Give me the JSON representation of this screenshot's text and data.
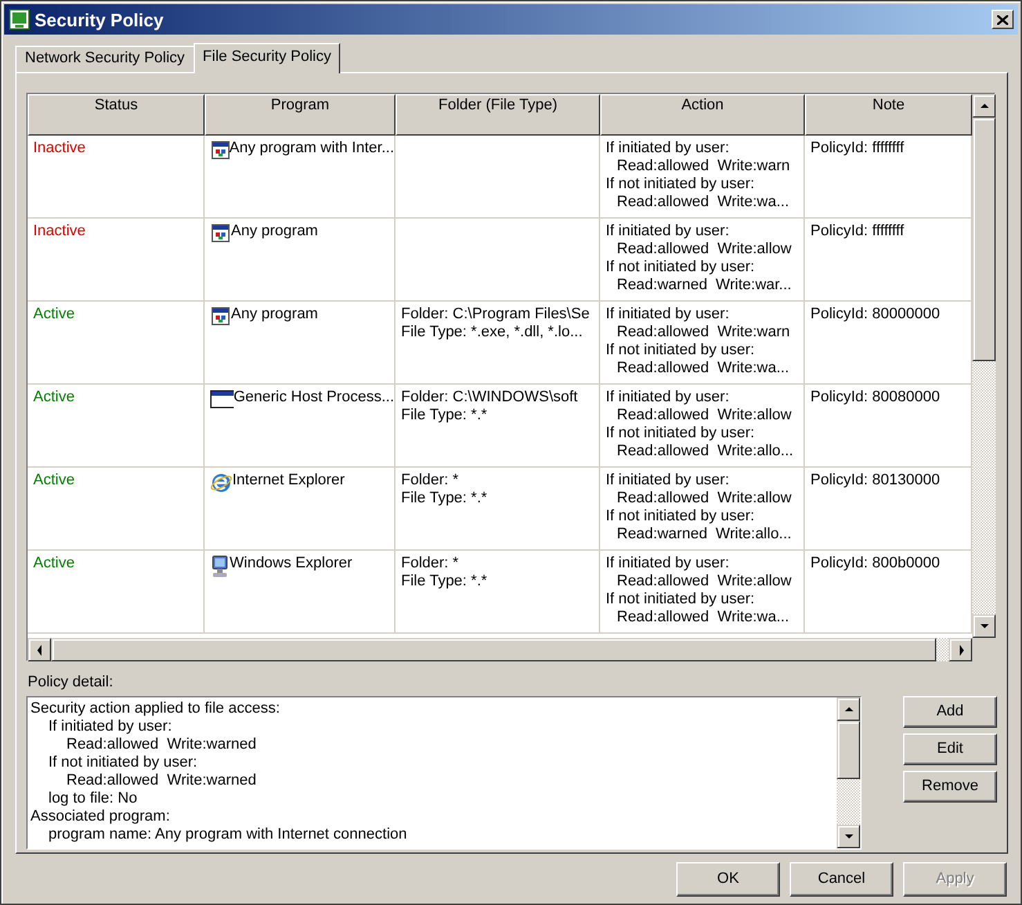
{
  "window": {
    "title": "Security Policy"
  },
  "tabs": [
    {
      "label": "Network Security Policy",
      "selected": false
    },
    {
      "label": "File Security Policy",
      "selected": true
    }
  ],
  "table": {
    "columns": [
      "Status",
      "Program",
      "Folder (File Type)",
      "Action",
      "Note"
    ],
    "rows": [
      {
        "status": "Inactive",
        "active": false,
        "program": "Any program with Inter...",
        "kind": "app",
        "folder": [],
        "action": [
          "If initiated by user:",
          "Read:allowed  Write:warn",
          "If not initiated by user:",
          "Read:allowed  Write:wa..."
        ],
        "note": "PolicyId: ffffffff"
      },
      {
        "status": "Inactive",
        "active": false,
        "program": "Any program",
        "kind": "app",
        "folder": [],
        "action": [
          "If initiated by user:",
          "Read:allowed  Write:allow",
          "If not initiated by user:",
          "Read:warned  Write:war..."
        ],
        "note": "PolicyId: ffffffff"
      },
      {
        "status": "Active",
        "active": true,
        "program": "Any program",
        "kind": "app",
        "folder": [
          "Folder: C:\\Program Files\\Se",
          "File Type: *.exe, *.dll, *.lo..."
        ],
        "action": [
          "If initiated by user:",
          "Read:allowed  Write:warn",
          "If not initiated by user:",
          "Read:allowed  Write:wa..."
        ],
        "note": "PolicyId: 80000000"
      },
      {
        "status": "Active",
        "active": true,
        "program": "Generic Host Process...",
        "kind": "window",
        "folder": [
          "Folder: C:\\WINDOWS\\soft",
          "File Type: *.*"
        ],
        "action": [
          "If initiated by user:",
          "Read:allowed  Write:allow",
          "If not initiated by user:",
          "Read:allowed  Write:allo..."
        ],
        "note": "PolicyId: 80080000"
      },
      {
        "status": "Active",
        "active": true,
        "program": "Internet Explorer",
        "kind": "browser",
        "folder": [
          "Folder: *",
          "File Type: *.*"
        ],
        "action": [
          "If initiated by user:",
          "Read:allowed  Write:allow",
          "If not initiated by user:",
          "Read:warned  Write:allo..."
        ],
        "note": "PolicyId: 80130000"
      },
      {
        "status": "Active",
        "active": true,
        "program": "Windows Explorer",
        "kind": "computer",
        "folder": [
          "Folder: *",
          "File Type: *.*"
        ],
        "action": [
          "If initiated by user:",
          "Read:allowed  Write:allow",
          "If not initiated by user:",
          "Read:allowed  Write:wa..."
        ],
        "note": "PolicyId: 800b0000"
      }
    ]
  },
  "policy_detail": {
    "label": "Policy detail:",
    "lines": [
      {
        "text": "Security action applied to file access:",
        "children": [
          {
            "text": "If initiated by user:",
            "children": [
              {
                "text": "Read:allowed  Write:warned"
              }
            ]
          },
          {
            "text": "If not initiated by user:",
            "children": [
              {
                "text": "Read:allowed  Write:warned"
              }
            ]
          },
          {
            "text": "log to file: No"
          }
        ]
      },
      {
        "text": "Associated program:",
        "children": [
          {
            "text": "program name: Any program with Internet connection"
          }
        ]
      }
    ]
  },
  "side_buttons": [
    {
      "label": "Add",
      "disabled": false
    },
    {
      "label": "Edit",
      "disabled": false
    },
    {
      "label": "Remove",
      "disabled": false
    }
  ],
  "buttons": [
    {
      "label": "OK",
      "disabled": false
    },
    {
      "label": "Cancel",
      "disabled": false
    },
    {
      "label": "Apply",
      "disabled": true
    }
  ]
}
